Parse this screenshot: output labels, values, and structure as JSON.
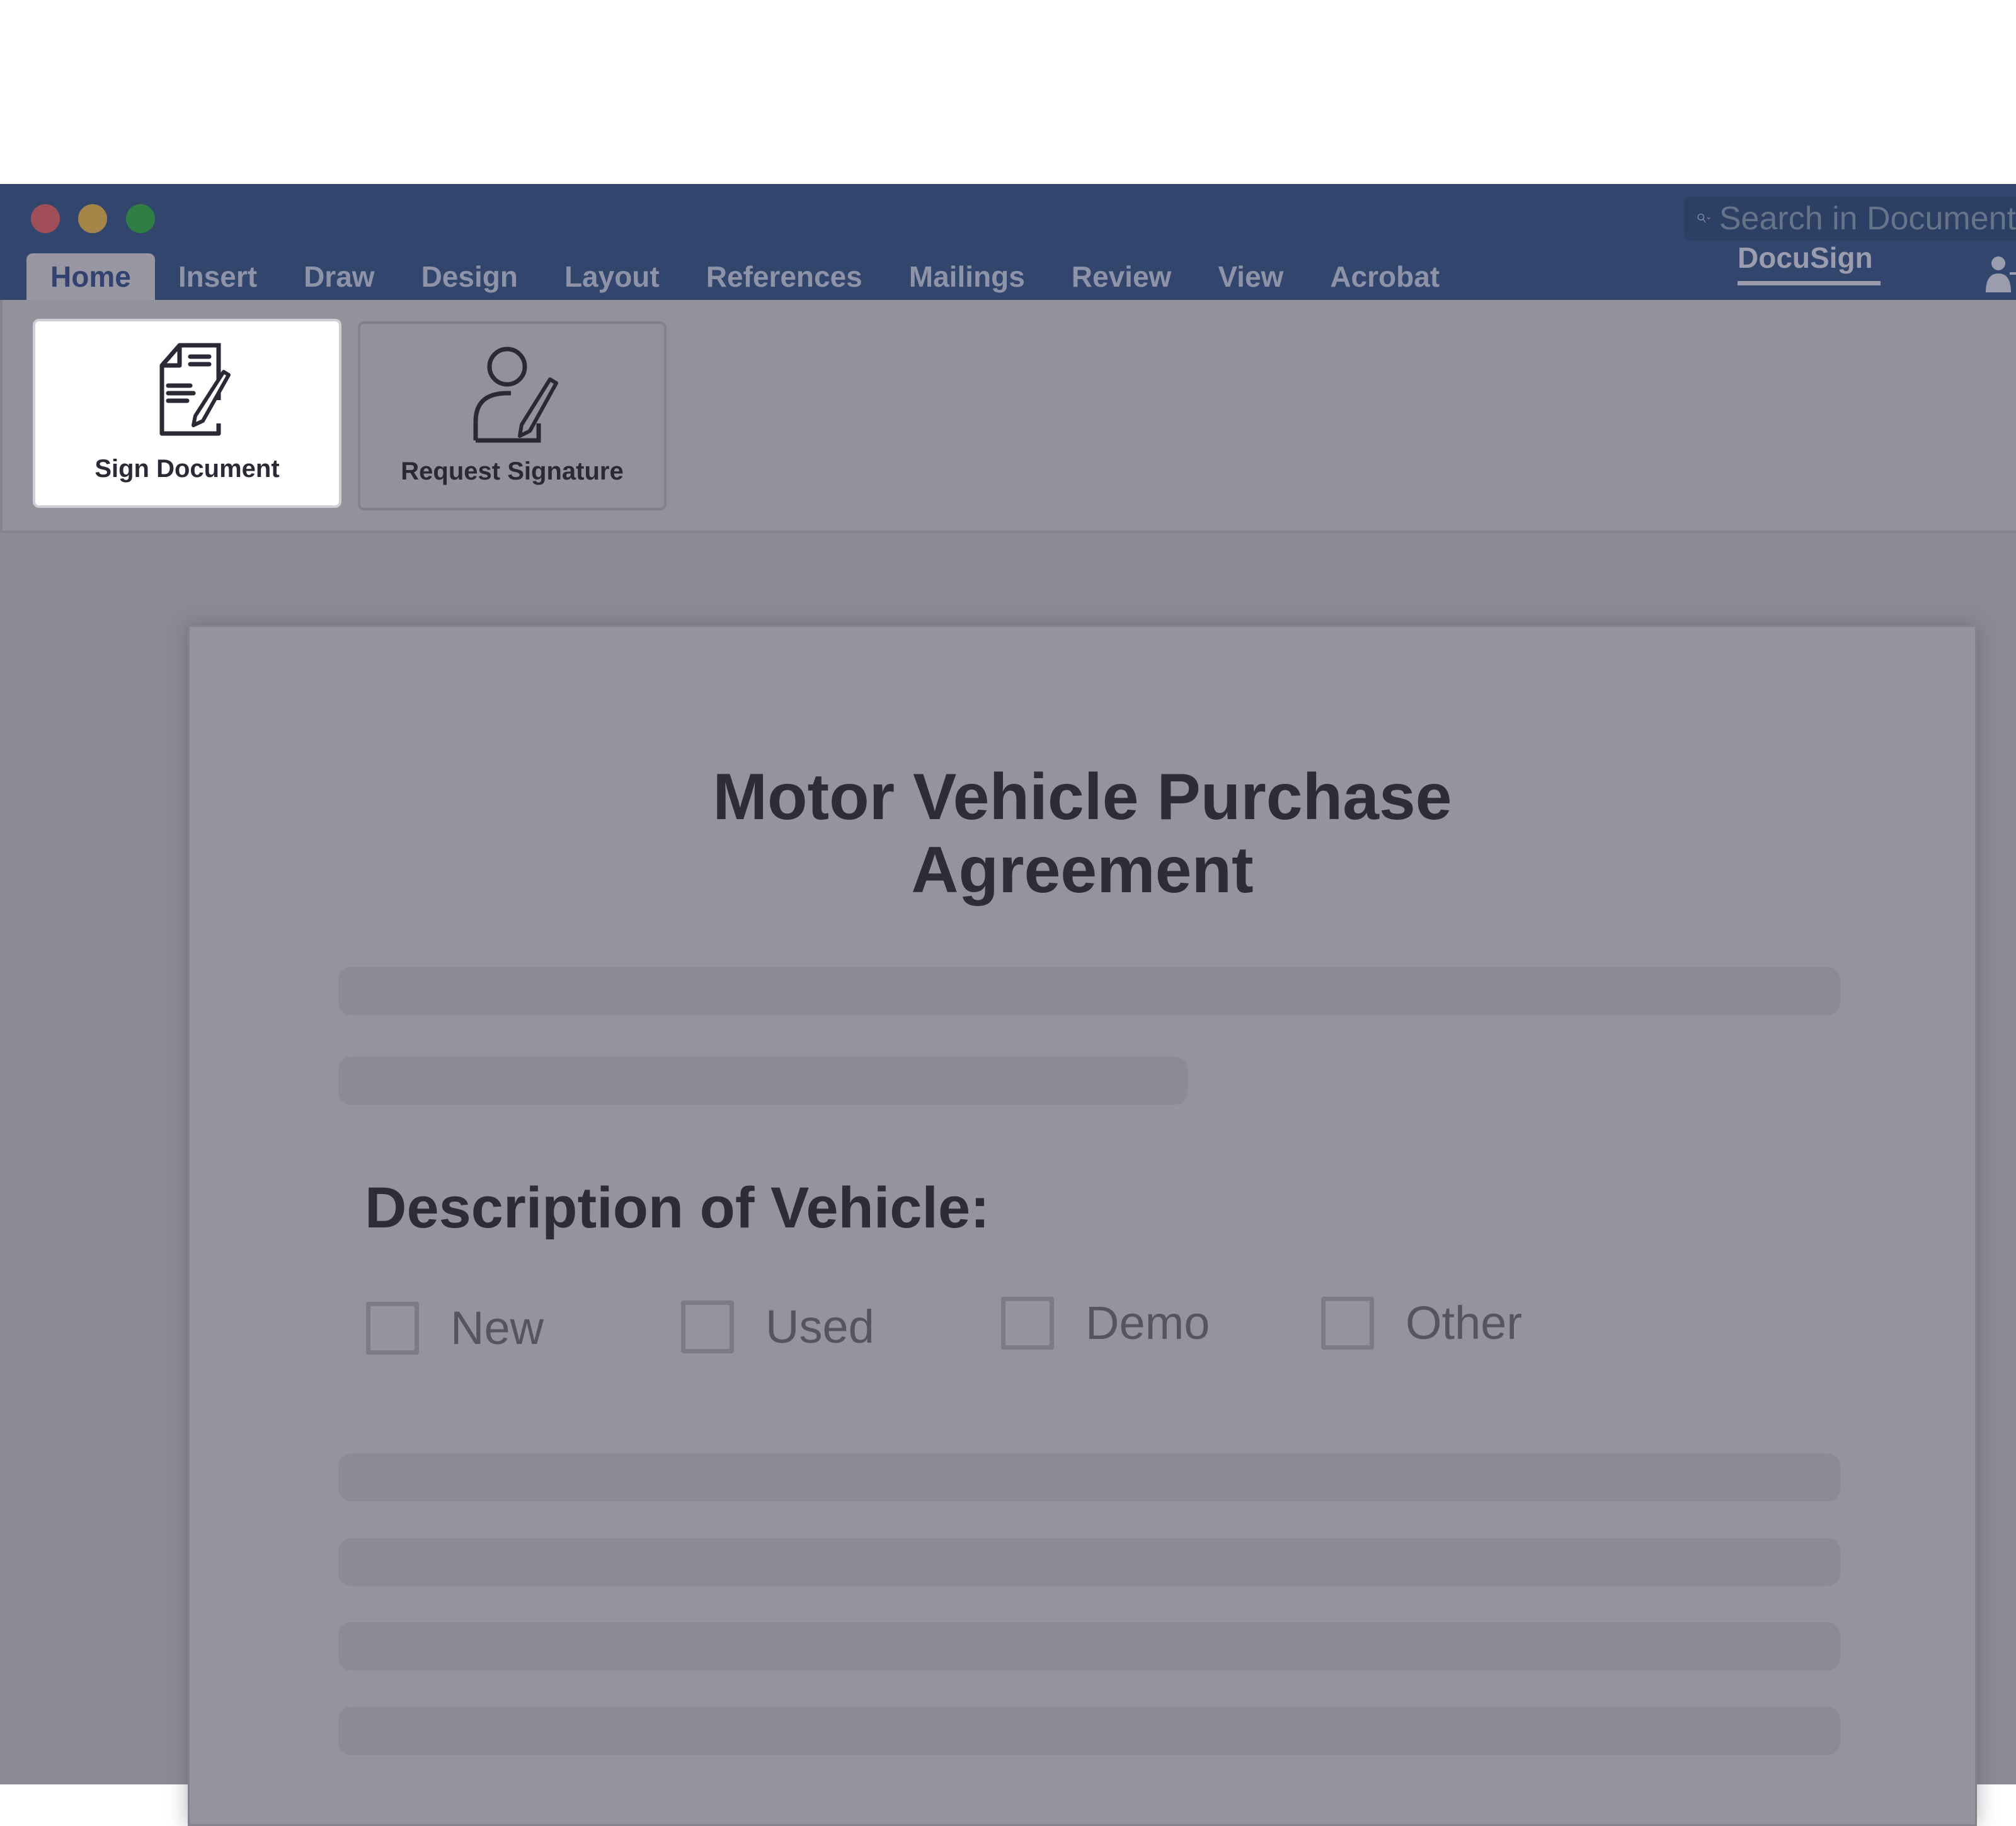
{
  "window": {
    "controls": [
      "close",
      "minimize",
      "maximize"
    ],
    "search": {
      "placeholder": "Search in Document"
    }
  },
  "menu": {
    "tabs": [
      {
        "label": "Home",
        "active": true
      },
      {
        "label": "Insert"
      },
      {
        "label": "Draw"
      },
      {
        "label": "Design"
      },
      {
        "label": "Layout"
      },
      {
        "label": "References"
      },
      {
        "label": "Mailings"
      },
      {
        "label": "Review"
      },
      {
        "label": "View"
      },
      {
        "label": "Acrobat"
      }
    ],
    "addin_tab": {
      "label": "DocuSign",
      "active": true
    },
    "user_icon": "person-add-icon"
  },
  "ribbon": {
    "buttons": [
      {
        "label": "Sign Document",
        "icon": "document-pen-icon",
        "highlighted": true
      },
      {
        "label": "Request Signature",
        "icon": "person-pen-icon"
      }
    ]
  },
  "document": {
    "title_line1": "Motor Vehicle Purchase",
    "title_line2": "Agreement",
    "section_heading": "Description of Vehicle:",
    "options": [
      {
        "label": "New",
        "checked": false
      },
      {
        "label": "Used",
        "checked": false
      },
      {
        "label": "Demo",
        "checked": false
      },
      {
        "label": "Other",
        "checked": false
      }
    ]
  },
  "colors": {
    "titlebar": "#31456d",
    "overlay_gray": "#93919c",
    "text_dark": "#2e2c39"
  }
}
